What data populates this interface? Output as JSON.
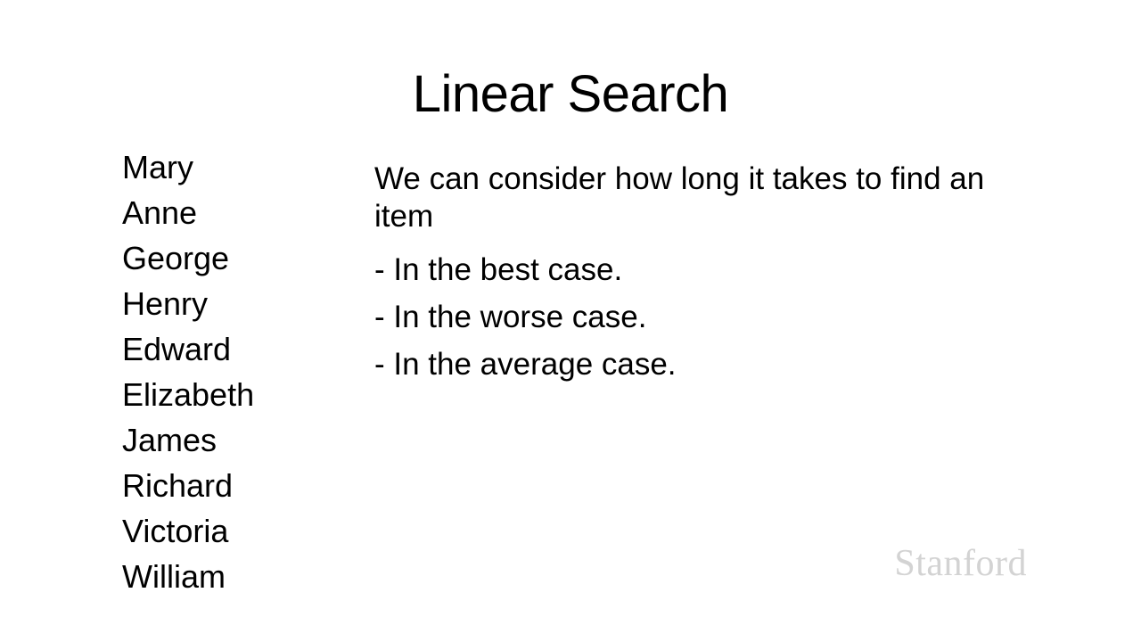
{
  "slide": {
    "title": "Linear Search",
    "names": [
      "Mary",
      "Anne",
      "George",
      "Henry",
      "Edward",
      "Elizabeth",
      "James",
      "Richard",
      "Victoria",
      "William"
    ],
    "intro": "We can consider how long it takes to find an item",
    "cases": [
      "- In the best case.",
      "- In the worse case.",
      "- In the average case."
    ],
    "watermark": "Stanford"
  }
}
